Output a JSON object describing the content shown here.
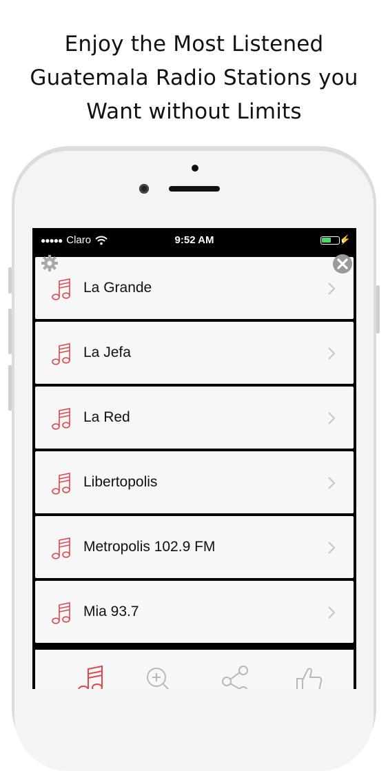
{
  "headline": {
    "line1": "Enjoy the Most Listened",
    "line2": "Guatemala Radio Stations you",
    "line3": "Want without Limits"
  },
  "status_bar": {
    "signal": "●●●●●",
    "carrier": "Claro",
    "time": "9:52 AM",
    "battery_level": 0.55,
    "charging_icon": "bolt-icon"
  },
  "toolbar": {
    "settings_icon": "gear-icon",
    "close_icon": "close-icon"
  },
  "stations": [
    {
      "name": "La Grande",
      "icon": "music-note-icon"
    },
    {
      "name": "La Jefa",
      "icon": "music-note-icon"
    },
    {
      "name": "La Red",
      "icon": "music-note-icon"
    },
    {
      "name": "Libertopolis",
      "icon": "music-note-icon"
    },
    {
      "name": "Metropolis 102.9 FM",
      "icon": "music-note-icon"
    },
    {
      "name": "Mia 93.7",
      "icon": "music-note-icon"
    }
  ],
  "tab_bar": {
    "tabs": [
      {
        "icon": "music-note-icon",
        "active": true
      },
      {
        "icon": "search-icon",
        "active": false
      },
      {
        "icon": "share-icon",
        "active": false
      },
      {
        "icon": "thumbs-up-icon",
        "active": false
      }
    ]
  },
  "colors": {
    "accent": "#e0464e",
    "inactive_icon": "#b8b8b8",
    "list_bg": "#f7f7f7",
    "separator": "#000000",
    "battery": "#4cd964"
  }
}
